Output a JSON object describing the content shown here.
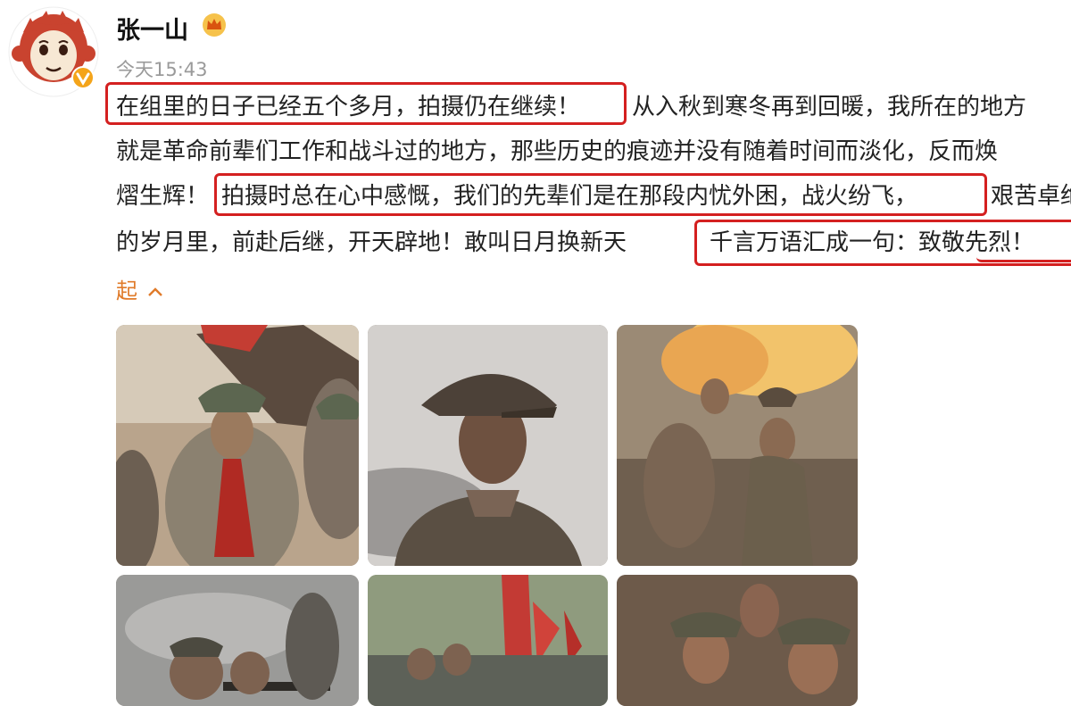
{
  "header": {
    "username": "张一山",
    "timestamp": "今天15:43"
  },
  "post": {
    "lines": [
      [
        "在组里的日子已经五个多月，拍摄仍在继续！",
        "从入秋到寒冬再到回暖，我所在的地方"
      ],
      [
        "就是革命前辈们工作和战斗过的地方，那些历史的痕迹并没有随着时间而淡化，反而焕"
      ],
      [
        "熠生辉！",
        "拍摄时总在心中感慨，我们的先辈们是在那段内忧外困，战火纷飞，",
        "艰苦卓绝"
      ],
      [
        "的岁月里，前赴后继，开天辟地！敢叫日月换新天",
        "千言万语汇成一句：致敬先烈！"
      ]
    ],
    "collapse_label": "起",
    "collapse_icon": "chevron-up-icon"
  },
  "colors": {
    "highlight": "#d42020",
    "link": "#e07b2a",
    "crown": "#f2a81d",
    "verified": "#f4a41a"
  },
  "icons": {
    "avatar": "monkey-avatar-icon",
    "verified": "verified-badge-icon",
    "member": "crown-icon"
  },
  "images": [
    "photo-soldiers-with-red-scarves",
    "photo-soldier-portrait",
    "photo-battle-scene",
    "photo-soldiers-aiming",
    "photo-soldiers-with-red-flags",
    "photo-soldiers-group"
  ]
}
